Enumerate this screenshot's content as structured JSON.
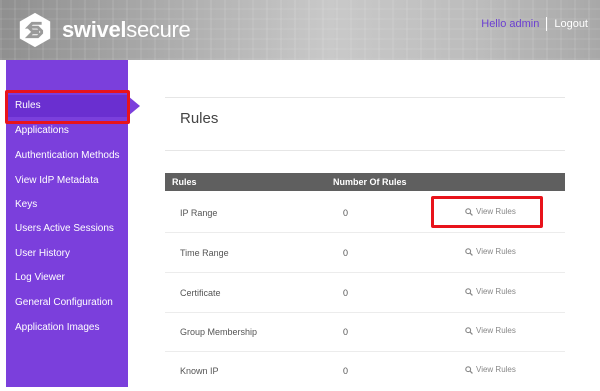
{
  "header": {
    "brand_bold": "swivel",
    "brand_light": "secure",
    "hello": "Hello admin",
    "logout": "Logout"
  },
  "sidebar": {
    "items": [
      {
        "label": "Rules"
      },
      {
        "label": "Applications"
      },
      {
        "label": "Authentication Methods"
      },
      {
        "label": "View IdP Metadata"
      },
      {
        "label": "Keys"
      },
      {
        "label": "Users Active Sessions"
      },
      {
        "label": "User History"
      },
      {
        "label": "Log Viewer"
      },
      {
        "label": "General Configuration"
      },
      {
        "label": "Application Images"
      }
    ]
  },
  "main": {
    "title": "Rules",
    "table": {
      "headers": [
        "Rules",
        "Number Of Rules"
      ],
      "rows": [
        {
          "name": "IP Range",
          "count": "0",
          "link": "View Rules"
        },
        {
          "name": "Time Range",
          "count": "0",
          "link": "View Rules"
        },
        {
          "name": "Certificate",
          "count": "0",
          "link": "View Rules"
        },
        {
          "name": "Group Membership",
          "count": "0",
          "link": "View Rules"
        },
        {
          "name": "Known IP",
          "count": "0",
          "link": "View Rules"
        }
      ]
    }
  },
  "colors": {
    "accent": "#7b3fdc",
    "highlight": "#e8131b",
    "table_header": "#5f5f5f"
  }
}
